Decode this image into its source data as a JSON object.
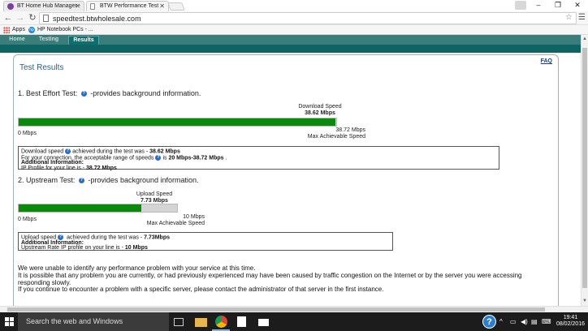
{
  "browser": {
    "tabs": [
      {
        "label": "BT Home Hub Manager -",
        "active": false
      },
      {
        "label": "BTW Performance Test",
        "active": true
      }
    ],
    "url": "speedtest.btwholesale.com",
    "bookmarks": [
      {
        "label": "Apps"
      },
      {
        "label": "HP Notebook PCs - ..."
      }
    ]
  },
  "site": {
    "nav_tabs": [
      "Home",
      "Testing",
      "Results"
    ],
    "selected_tab": "Results",
    "nav_color": "#3b7d7a"
  },
  "results": {
    "title": "Test Results",
    "faq": "FAQ",
    "download": {
      "heading_num": "1.",
      "heading": "Best Effort Test:",
      "heading_suffix": "-provides background information.",
      "speed_label": "Download Speed",
      "speed_value": "38.62 Mbps",
      "min_label": "0 Mbps",
      "max_value": "38.72 Mbps",
      "max_label": "Max Achievable Speed",
      "fill_fraction": 0.9974,
      "box_line1_a": "Download speed",
      "box_line1_b": "achieved during the test was - ",
      "box_line1_val": "38.62 Mbps",
      "box_line2_a": "For your connection, the acceptable range of speeds",
      "box_line2_b": "is ",
      "box_line2_val": "20 Mbps-38.72 Mbps",
      "box_line2_end": " .",
      "box_line3": "Additional Information:",
      "box_line4_a": "IP Profile for your line is - ",
      "box_line4_val": "38.72 Mbps"
    },
    "upload": {
      "heading_num": "2.",
      "heading": "Upstream Test:",
      "heading_suffix": "-provides background information.",
      "speed_label": "Upload Speed",
      "speed_value": "7.73 Mbps",
      "min_label": "0 Mbps",
      "max_value": "10 Mbps",
      "max_label": "Max Achievable Speed",
      "fill_fraction": 0.773,
      "box_line1_a": "Upload speed",
      "box_line1_b": " achieved during the test was - ",
      "box_line1_val": "7.73Mbps",
      "box_line2": "Additional Information:",
      "box_line3_a": "Upstream Rate IP profile on your line is - ",
      "box_line3_val": "10 Mbps"
    },
    "message": {
      "line1": "We were unable to identify any performance problem with your service at this time.",
      "line2": "It is possible that any problem you are currently, or had previously experienced may have been caused by traffic congestion on the Internet or by the server you were accessing responding slowly.",
      "line3": "If you continue to encounter a problem with a specific server, please contact the administrator of that server in the first instance."
    }
  },
  "taskbar": {
    "search_placeholder": "Search the web and Windows",
    "time": "19:41",
    "date": "08/02/2016"
  }
}
